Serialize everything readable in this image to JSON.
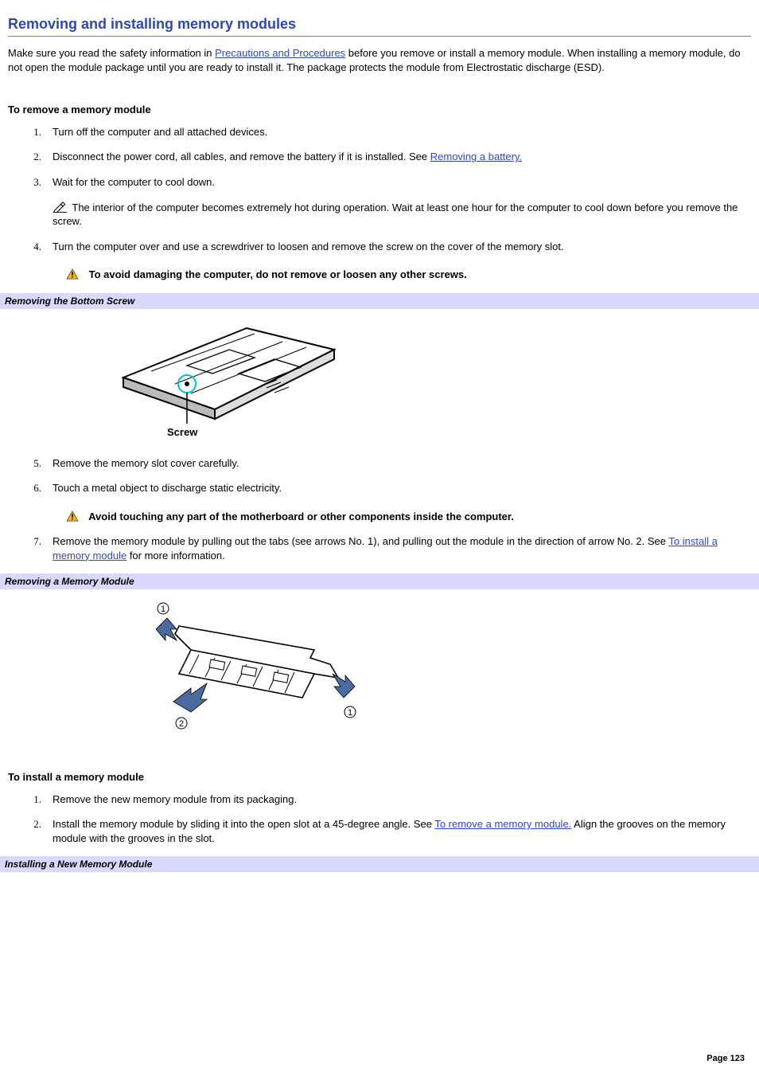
{
  "title": "Removing and installing memory modules",
  "intro_pre": "Make sure you read the safety information in ",
  "intro_link1": "Precautions and Procedures",
  "intro_post": " before you remove or install a memory module. When installing a memory module, do not open the module package until you are ready to install it. The package protects the module from Electrostatic discharge (ESD).",
  "remove_head": "To remove a memory module",
  "remove_steps": {
    "s1": "Turn off the computer and all attached devices.",
    "s2_pre": "Disconnect the power cord, all cables, and remove the battery if it is installed. See ",
    "s2_link": "Removing a battery.",
    "s3": "Wait for the computer to cool down.",
    "s3_note": "The interior of the computer becomes extremely hot during operation. Wait at least one hour for the computer to cool down before you remove the screw.",
    "s4": "Turn the computer over and use a screwdriver to loosen and remove the screw on the cover of the memory slot.",
    "s4_caution": "To avoid damaging the computer, do not remove or loosen any other screws.",
    "s5": "Remove the memory slot cover carefully.",
    "s6": "Touch a metal object to discharge static electricity.",
    "s6_caution": "Avoid touching any part of the motherboard or other components inside the computer.",
    "s7_pre": "Remove the memory module by pulling out the tabs (see arrows No. 1), and pulling out the module in the direction of arrow No. 2. See ",
    "s7_link": "To install a memory module",
    "s7_post": " for more information."
  },
  "fig1_caption": "Removing the Bottom Screw",
  "fig1_label": "Screw",
  "fig2_caption": "Removing a Memory Module",
  "install_head": "To install a memory module",
  "install_steps": {
    "s1": "Remove the new memory module from its packaging.",
    "s2_pre": "Install the memory module by sliding it into the open slot at a 45-degree angle. See ",
    "s2_link": "To remove a memory module.",
    "s2_post": " Align the grooves on the memory module with the grooves in the slot."
  },
  "fig3_caption": "Installing a New Memory Module",
  "footer": "Page 123"
}
